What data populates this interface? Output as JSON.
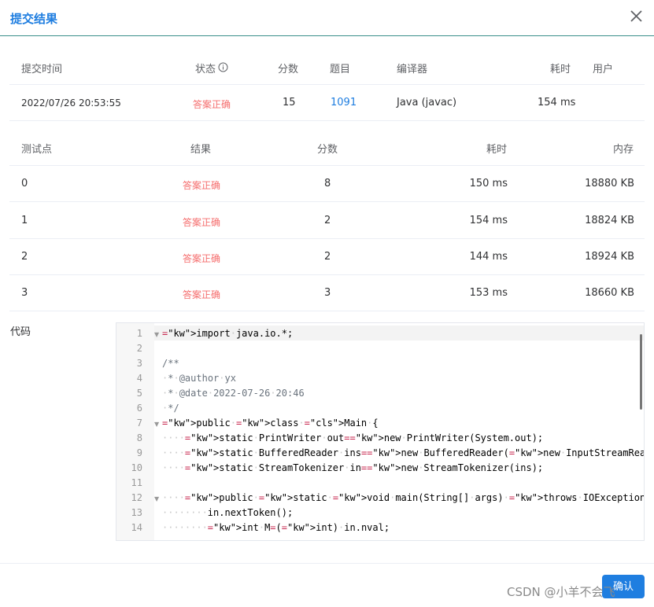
{
  "dialog": {
    "title": "提交结果",
    "confirm_label": "确认"
  },
  "submission": {
    "headers": {
      "time": "提交时间",
      "status": "状态",
      "score": "分数",
      "problem": "题目",
      "compiler": "编译器",
      "duration": "耗时",
      "user": "用户"
    },
    "status_info_icon": "info-icon",
    "row": {
      "time": "2022/07/26 20:53:55",
      "status": "答案正确",
      "score": "15",
      "problem": "1091",
      "compiler": "Java (javac)",
      "duration": "154 ms",
      "user": ""
    }
  },
  "testcases": {
    "headers": {
      "id": "测试点",
      "result": "结果",
      "score": "分数",
      "duration": "耗时",
      "memory": "内存"
    },
    "rows": [
      {
        "id": "0",
        "result": "答案正确",
        "score": "8",
        "duration": "150 ms",
        "memory": "18880 KB"
      },
      {
        "id": "1",
        "result": "答案正确",
        "score": "2",
        "duration": "154 ms",
        "memory": "18824 KB"
      },
      {
        "id": "2",
        "result": "答案正确",
        "score": "2",
        "duration": "144 ms",
        "memory": "18924 KB"
      },
      {
        "id": "3",
        "result": "答案正确",
        "score": "3",
        "duration": "153 ms",
        "memory": "18660 KB"
      }
    ]
  },
  "code": {
    "label": "代码",
    "lines": [
      {
        "n": "1",
        "text": "import java.io.*;"
      },
      {
        "n": "2",
        "text": ""
      },
      {
        "n": "3",
        "text": "/**"
      },
      {
        "n": "4",
        "text": " * @author yx"
      },
      {
        "n": "5",
        "text": " * @date 2022-07-26 20:46"
      },
      {
        "n": "6",
        "text": " */"
      },
      {
        "n": "7",
        "text": "public class Main {"
      },
      {
        "n": "8",
        "text": "    static PrintWriter out=new PrintWriter(System.out);"
      },
      {
        "n": "9",
        "text": "    static BufferedReader ins=new BufferedReader(new InputStreamReader(System.in));"
      },
      {
        "n": "10",
        "text": "    static StreamTokenizer in=new StreamTokenizer(ins);"
      },
      {
        "n": "11",
        "text": ""
      },
      {
        "n": "12",
        "text": "    public static void main(String[] args) throws IOException {"
      },
      {
        "n": "13",
        "text": "        in.nextToken();"
      },
      {
        "n": "14",
        "text": "        int M=(int) in.nval;"
      }
    ]
  },
  "watermark": "CSDN @小羊不会飞",
  "colors": {
    "accent": "#1f7ee0",
    "success_text": "#f56c6c"
  }
}
